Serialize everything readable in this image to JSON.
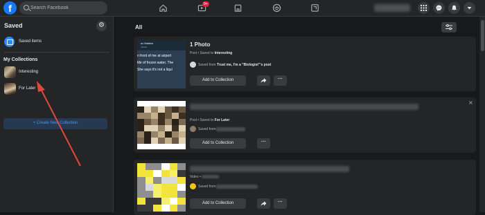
{
  "header": {
    "logo_letter": "f",
    "search_placeholder": "Search Facebook",
    "watch_badge": "9+"
  },
  "sidebar": {
    "title": "Saved",
    "saved_items_label": "Saved items",
    "my_collections_label": "My Collections",
    "collections": [
      {
        "label": "Interesting"
      },
      {
        "label": "For Later"
      }
    ],
    "create_button_label": "+ Create New Collection"
  },
  "main": {
    "filter_label": "All",
    "cards": [
      {
        "title": "1 Photo",
        "meta_prefix": "Post • Saved to ",
        "meta_collection": "Interesting",
        "source_prefix": "Saved from ",
        "source_name": "Trust me, I'm a \"Biologist\"'s post",
        "add_label": "Add to Collection",
        "more_label": "···",
        "thumb_lines": [
          "uc Haston",
          "mputer",
          "n front of me at airport",
          "ttle of frozen water. The",
          "She says it's not a liqui"
        ]
      },
      {
        "title": "",
        "meta_prefix": "Post • Saved to ",
        "meta_collection": "For Later",
        "source_prefix": "Saved from ",
        "source_name": "",
        "add_label": "Add to Collection",
        "more_label": "···"
      },
      {
        "title": "",
        "meta_prefix": "Video • ",
        "meta_collection": "",
        "source_prefix": "Saved from ",
        "source_name": "",
        "add_label": "Add to Collection",
        "more_label": "···"
      }
    ]
  },
  "colors": {
    "accent": "#1877f2",
    "annotation_arrow": "#e0483e",
    "background": "#18191a",
    "surface": "#242526"
  }
}
